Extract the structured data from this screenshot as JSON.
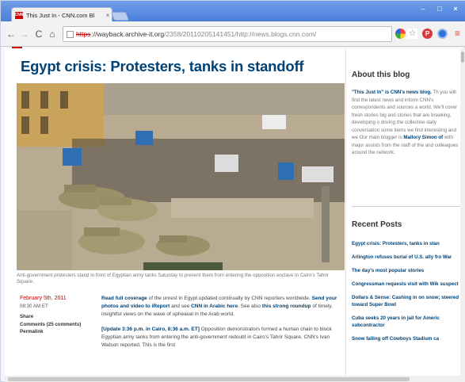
{
  "browser": {
    "tab_title": "This Just In - CNN.com Bl",
    "tab_favicon_text": "CNN",
    "tab_close": "×",
    "url_protocol": "https",
    "url_host": "://wayback.archive-it.org",
    "url_rest": "/2358/20110205141451/http://news.blogs.cnn.com/",
    "window_min": "–",
    "window_max": "□",
    "window_close": "×"
  },
  "icons": {
    "back": "←",
    "forward": "→",
    "reload": "C",
    "home": "⌂",
    "star": "☆",
    "pinterest": "P",
    "menu": "≡"
  },
  "article": {
    "headline": "Egypt crisis: Protesters, tanks in standoff",
    "caption": "Anti-government protesters stand in front of Egyptian army tanks Saturday to prevent them from entering the opposition enclave in Cairo's Tahrir Square.",
    "date": "February 5th, 2011",
    "time": "08:30 AM ET",
    "share": "Share",
    "comments": "Comments (25 comments)",
    "permalink": "Permalink",
    "para1_link1": "Read full coverage",
    "para1_a": " of the unrest in Egypt updated continually by CNN reporters worldwide. ",
    "para1_link2": "Send your photos and video to iReport",
    "para1_b": " and see ",
    "para1_link3": "CNN in Arabic here",
    "para1_c": ". See also ",
    "para1_link4": "this strong roundup",
    "para1_d": " of timely, insightful views on the wave of upheaval in the Arab world.",
    "para2_link": "[Update 3:36 p.m. in Cairo, 8:36 a.m. ET]",
    "para2_text": " Opposition demonstrators formed a human chain to block Egyptian army tanks from entering the anti-government redoubt in Cairo's Tahrir Square, CNN's Ivan Watson reported. This is the first"
  },
  "sidebar": {
    "about_heading": "About this blog",
    "about_link": "\"This Just In\" is CNN's news blog.",
    "about_text": " Th you will find the latest news and inform CNN's correspondents and sources a world. We'll cover fresh stories big and stories that are breaking, developing o driving the collective daily conversation some items we find interesting and we Our main blogger is ",
    "about_name": "Mallory Simon of",
    "about_text2": " with major assists from the staff of the and colleagues around the network.",
    "recent_heading": "Recent Posts",
    "recent_posts": [
      "Egypt crisis: Protesters, tanks in stan",
      "Arlington refuses burial of U.S. ally fro War",
      "The day's most popular stories",
      "Congressman requests visit with Wik suspect",
      "Dollars & Sense: Cashing in on snow; steered toward Super Bowl",
      "Cuba seeks 20 years in jail for Americ subcontractor",
      "Snow falling off Cowboys Stadium ca"
    ]
  }
}
